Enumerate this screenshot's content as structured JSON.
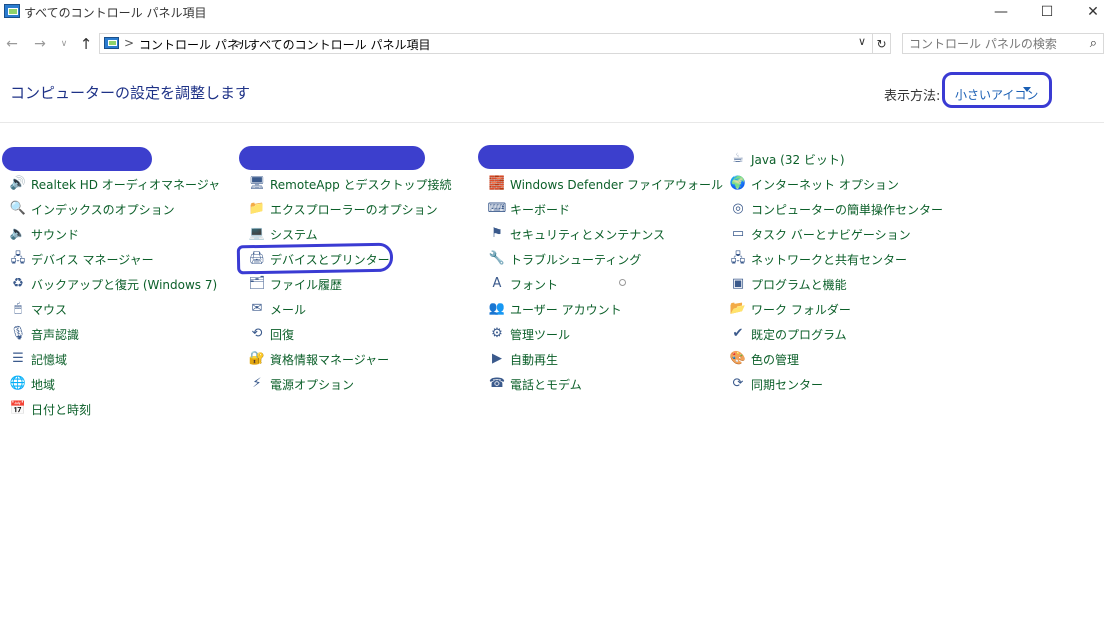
{
  "window": {
    "title": "すべてのコントロール パネル項目",
    "minimize": "—",
    "maximize": "☐",
    "close": "✕"
  },
  "nav": {
    "back": "←",
    "forward": "→",
    "recent": "∨",
    "up": "↑",
    "separator": ">",
    "breadcrumb": [
      "コントロール パネル",
      "すべてのコントロール パネル項目"
    ],
    "dropdown": "∨",
    "refresh": "↻"
  },
  "search": {
    "placeholder": "コントロール パネルの検索",
    "icon": "⌕"
  },
  "header": {
    "title": "コンピューターの設定を調整します",
    "view_label": "表示方法:",
    "view_value": "小さいアイコン"
  },
  "columns": [
    [
      {
        "label": "Realtek HD オーディオマネージャ",
        "icon": "speaker-icon",
        "glyph": "🔊"
      },
      {
        "label": "インデックスのオプション",
        "icon": "index-options-icon",
        "glyph": "🔍"
      },
      {
        "label": "サウンド",
        "icon": "sound-icon",
        "glyph": "🔈"
      },
      {
        "label": "デバイス マネージャー",
        "icon": "device-manager-icon",
        "glyph": "🖧"
      },
      {
        "label": "バックアップと復元 (Windows 7)",
        "icon": "backup-icon",
        "glyph": "♻"
      },
      {
        "label": "マウス",
        "icon": "mouse-icon",
        "glyph": "🖱"
      },
      {
        "label": "音声認識",
        "icon": "microphone-icon",
        "glyph": "🎙"
      },
      {
        "label": "記憶域",
        "icon": "storage-icon",
        "glyph": "☰"
      },
      {
        "label": "地域",
        "icon": "globe-icon",
        "glyph": "🌐"
      },
      {
        "label": "日付と時刻",
        "icon": "calendar-icon",
        "glyph": "📅"
      }
    ],
    [
      {
        "label": "RemoteApp とデスクトップ接続",
        "icon": "remoteapp-icon",
        "glyph": "🖥"
      },
      {
        "label": "エクスプローラーのオプション",
        "icon": "folder-options-icon",
        "glyph": "📁"
      },
      {
        "label": "システム",
        "icon": "system-icon",
        "glyph": "💻"
      },
      {
        "label": "デバイスとプリンター",
        "icon": "printer-icon",
        "glyph": "🖨"
      },
      {
        "label": "ファイル履歴",
        "icon": "file-history-icon",
        "glyph": "🗂"
      },
      {
        "label": "メール",
        "icon": "mail-icon",
        "glyph": "✉"
      },
      {
        "label": "回復",
        "icon": "recovery-icon",
        "glyph": "⟲"
      },
      {
        "label": "資格情報マネージャー",
        "icon": "credential-icon",
        "glyph": "🔐"
      },
      {
        "label": "電源オプション",
        "icon": "power-icon",
        "glyph": "⚡"
      }
    ],
    [
      {
        "label": "Windows Defender ファイアウォール",
        "icon": "firewall-icon",
        "glyph": "🧱"
      },
      {
        "label": "キーボード",
        "icon": "keyboard-icon",
        "glyph": "⌨"
      },
      {
        "label": "セキュリティとメンテナンス",
        "icon": "flag-icon",
        "glyph": "⚑"
      },
      {
        "label": "トラブルシューティング",
        "icon": "troubleshoot-icon",
        "glyph": "🔧"
      },
      {
        "label": "フォント",
        "icon": "font-icon",
        "glyph": "A"
      },
      {
        "label": "ユーザー アカウント",
        "icon": "users-icon",
        "glyph": "👥"
      },
      {
        "label": "管理ツール",
        "icon": "admin-tools-icon",
        "glyph": "⚙"
      },
      {
        "label": "自動再生",
        "icon": "autoplay-icon",
        "glyph": "▶"
      },
      {
        "label": "電話とモデム",
        "icon": "phone-modem-icon",
        "glyph": "☎"
      }
    ],
    [
      {
        "label": "Java (32 ビット)",
        "icon": "java-icon",
        "glyph": "☕"
      },
      {
        "label": "インターネット オプション",
        "icon": "internet-options-icon",
        "glyph": "🌍"
      },
      {
        "label": "コンピューターの簡単操作センター",
        "icon": "ease-of-access-icon",
        "glyph": "◎"
      },
      {
        "label": "タスク バーとナビゲーション",
        "icon": "taskbar-icon",
        "glyph": "▭"
      },
      {
        "label": "ネットワークと共有センター",
        "icon": "network-icon",
        "glyph": "🖧"
      },
      {
        "label": "プログラムと機能",
        "icon": "programs-icon",
        "glyph": "▣"
      },
      {
        "label": "ワーク フォルダー",
        "icon": "work-folders-icon",
        "glyph": "📂"
      },
      {
        "label": "既定のプログラム",
        "icon": "default-programs-icon",
        "glyph": "✔"
      },
      {
        "label": "色の管理",
        "icon": "color-management-icon",
        "glyph": "🎨"
      },
      {
        "label": "同期センター",
        "icon": "sync-icon",
        "glyph": "⟳"
      }
    ]
  ],
  "colors": {
    "link": "#0b5f29",
    "title": "#1e3287",
    "annotation": "#3a3bd3"
  }
}
